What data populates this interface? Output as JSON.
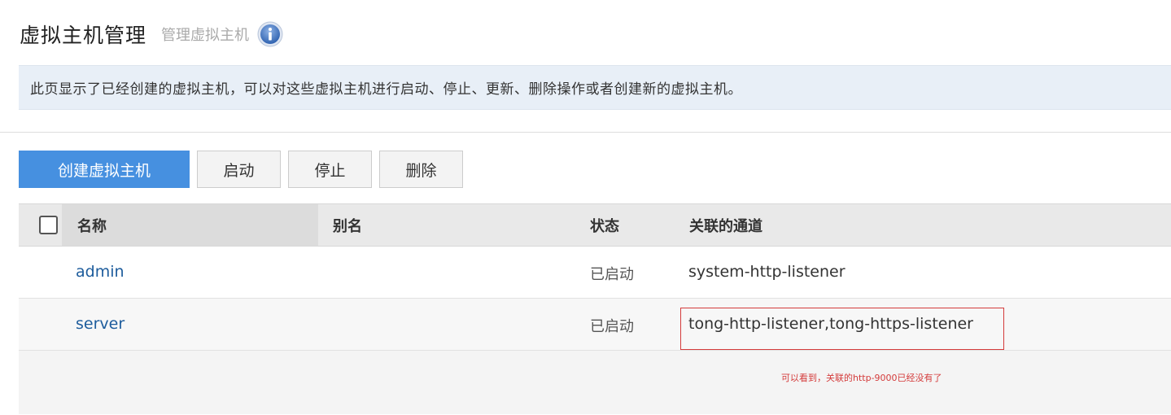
{
  "header": {
    "title": "虚拟主机管理",
    "subtitle": "管理虚拟主机",
    "info_icon": "info-icon"
  },
  "description": "此页显示了已经创建的虚拟主机，可以对这些虚拟主机进行启动、停止、更新、删除操作或者创建新的虚拟主机。",
  "toolbar": {
    "create_label": "创建虚拟主机",
    "start_label": "启动",
    "stop_label": "停止",
    "delete_label": "删除"
  },
  "table": {
    "columns": [
      "名称",
      "别名",
      "状态",
      "关联的通道"
    ],
    "rows": [
      {
        "name": "admin",
        "alias": "",
        "status": "已启动",
        "channel": "system-http-listener"
      },
      {
        "name": "server",
        "alias": "",
        "status": "已启动",
        "channel": "tong-http-listener,tong-https-listener"
      }
    ]
  },
  "annotation": {
    "text": "可以看到，关联的http-9000已经没有了",
    "color": "#d43b3b"
  },
  "colors": {
    "primary": "#4690e0",
    "link": "#1d5c9c",
    "desc_bg": "#e8eff7"
  }
}
